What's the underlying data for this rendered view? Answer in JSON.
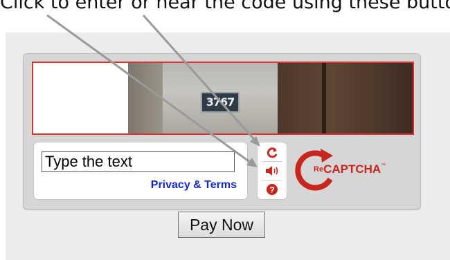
{
  "caption": "Click to enter or hear the code using these buttons",
  "captcha": {
    "image_text": "3767",
    "input_value": "Type the text",
    "privacy_link": "Privacy & Terms",
    "buttons": {
      "reload_icon": "reload-icon",
      "audio_icon": "speaker-icon",
      "help_icon": "help-icon"
    },
    "logo": {
      "re": "Re",
      "name": "CAPTCHA",
      "tm": "™"
    }
  },
  "pay_button": "Pay Now",
  "colors": {
    "accent": "#c8251e",
    "link": "#1428c8",
    "frame_border": "#e03030",
    "panel_bg": "#ececec"
  }
}
